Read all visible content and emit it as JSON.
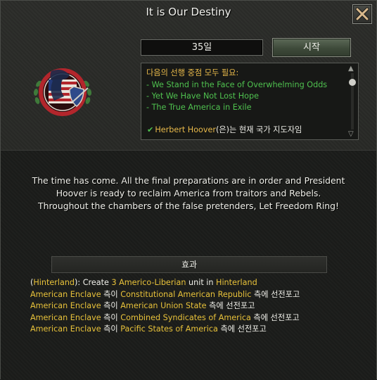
{
  "window": {
    "title": "It is Our Destiny"
  },
  "controls": {
    "days": "35일",
    "start_label": "시작"
  },
  "requirements": {
    "header": "다음의 선행 중점 모두 필요:",
    "items": [
      "- We Stand in the Face of Overwhelming Odds",
      "- Yet We Have Not Lost Hope",
      "- The True America in Exile"
    ],
    "leader_name": "Herbert Hoover",
    "leader_suffix": "(은)는 현재 국가 지도자임"
  },
  "description": {
    "line1": "The time has come. All the final preparations are in order and President",
    "line2": "Hoover is ready to reclaim America from traitors and Rebels.",
    "line3": "Throughout the chambers of the false pretenders, Let Freedom Ring!"
  },
  "effects": {
    "header": "효과",
    "line1": {
      "open": "(",
      "state": "Hinterland",
      "mid": "): Create ",
      "count_unit": "3 Americo-Liberian",
      "mid2": " unit in ",
      "state2": "Hinterland"
    },
    "wars": [
      {
        "actor": "American Enclave",
        "prep": " 측이 ",
        "target": "Constitutional American Republic",
        "suffix": " 측에 선전포고"
      },
      {
        "actor": "American Enclave",
        "prep": " 측이 ",
        "target": "American Union State",
        "suffix": " 측에 선전포고"
      },
      {
        "actor": "American Enclave",
        "prep": " 측이 ",
        "target": "Combined Syndicates of America",
        "suffix": " 측에 선전포고"
      },
      {
        "actor": "American Enclave",
        "prep": " 측이 ",
        "target": "Pacific States of America",
        "suffix": " 측에 선전포고"
      }
    ]
  },
  "colors": {
    "accent_gold": "#e8c23a",
    "requirement_green": "#4fc14f",
    "text_white": "#f0f0ea"
  },
  "icons": {
    "close": "close-x-icon",
    "emblem": "focus-emblem-icon",
    "check": "checkmark-icon"
  }
}
